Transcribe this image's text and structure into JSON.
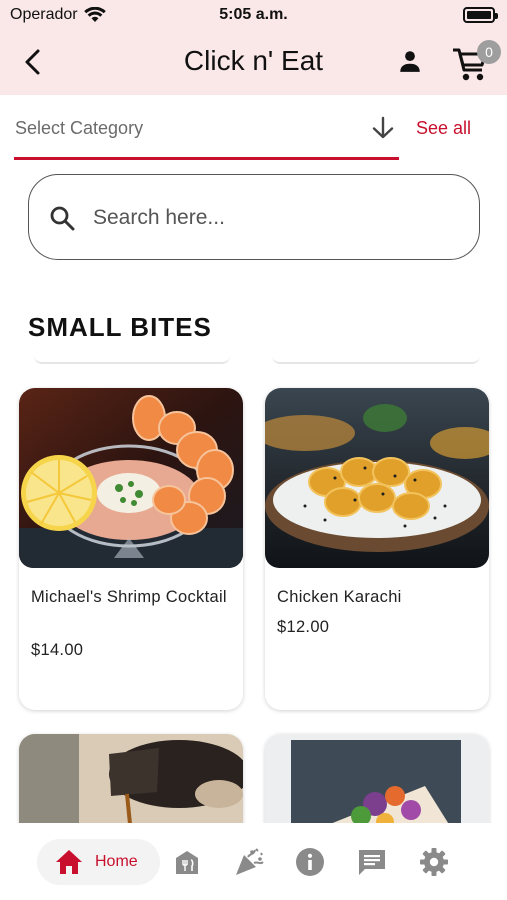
{
  "status_bar": {
    "carrier": "Operador",
    "time": "5:05 a.m."
  },
  "header": {
    "title": "Click n' Eat",
    "cart_count": "0"
  },
  "category": {
    "placeholder": "Select Category",
    "see_all": "See all"
  },
  "search": {
    "placeholder": "Search here..."
  },
  "section": {
    "title": "SMALL BITES"
  },
  "items": [
    {
      "name": "Michael's Shrimp Cocktail",
      "price": "$14.00"
    },
    {
      "name": "Chicken Karachi",
      "price": "$12.00"
    }
  ],
  "bottom_nav": {
    "home_label": "Home",
    "icons": [
      "home-icon",
      "restaurant-icon",
      "celebration-icon",
      "info-icon",
      "chat-icon",
      "settings-icon"
    ]
  },
  "colors": {
    "accent": "#c8102e",
    "header_bg": "#fae8e8",
    "inactive_icon": "#8a8a8a"
  }
}
